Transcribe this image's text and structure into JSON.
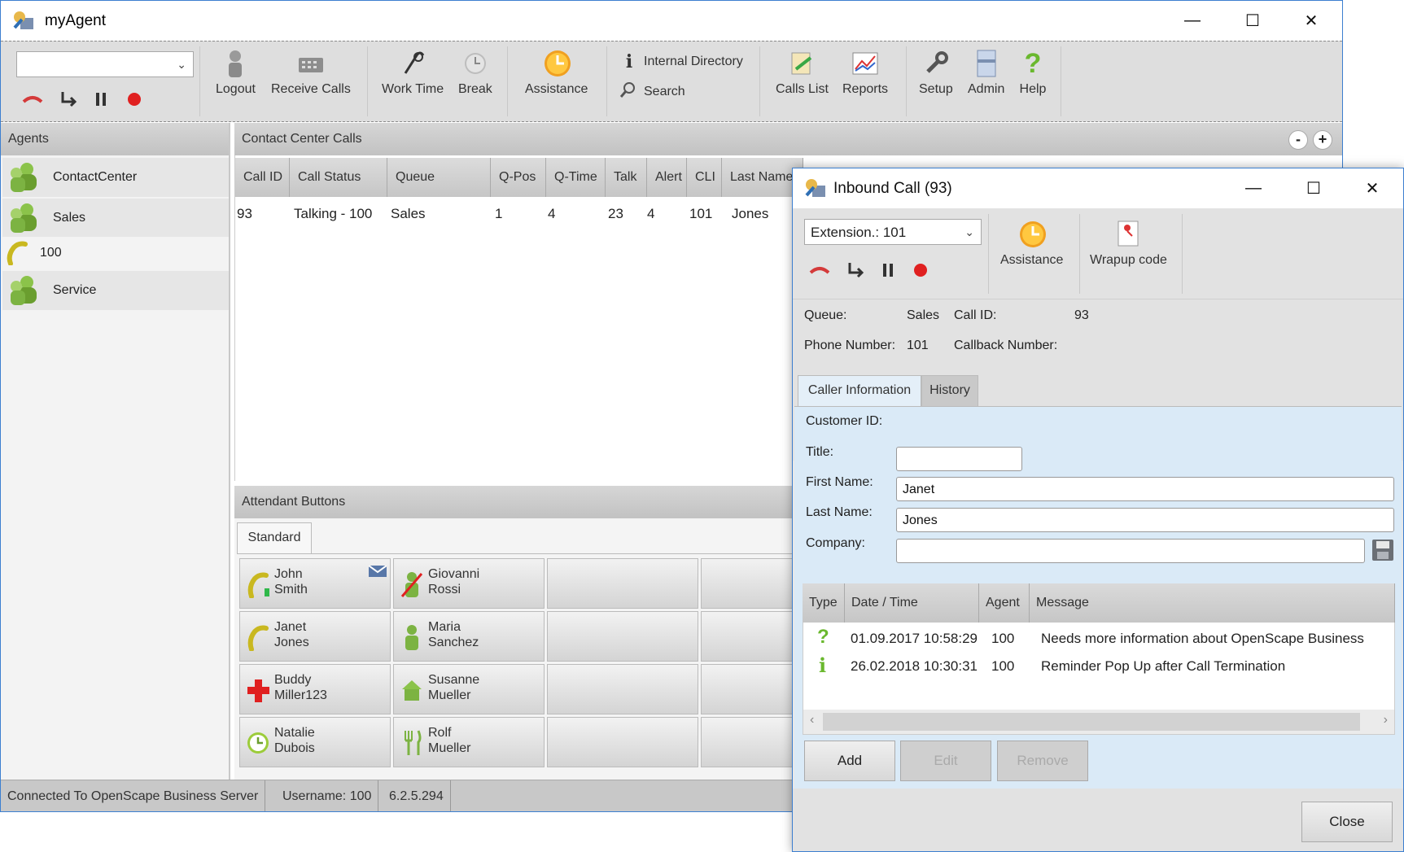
{
  "main": {
    "title": "myAgent",
    "window_controls": {
      "minimize": "—",
      "maximize": "☐",
      "close": "✕"
    },
    "toolbar": {
      "combo_value": "",
      "buttons": {
        "logout": "Logout",
        "receive_calls": "Receive Calls",
        "work_time": "Work Time",
        "break": "Break",
        "assistance": "Assistance",
        "internal_directory": "Internal Directory",
        "search": "Search",
        "calls_list": "Calls List",
        "reports": "Reports",
        "setup": "Setup",
        "admin": "Admin",
        "help": "Help"
      }
    },
    "agents_panel": {
      "title": "Agents",
      "items": [
        {
          "label": "ContactCenter",
          "icon": "agents-group-icon"
        },
        {
          "label": "Sales",
          "icon": "agents-group-icon"
        },
        {
          "label": "100",
          "icon": "phone-handset-icon"
        },
        {
          "label": "Service",
          "icon": "agents-group-icon"
        }
      ]
    },
    "calls_panel": {
      "title": "Contact Center Calls",
      "collapse": "-",
      "expand": "+",
      "columns": [
        "Call ID",
        "Call Status",
        "Queue",
        "Q-Pos",
        "Q-Time",
        "Talk",
        "Alert",
        "CLI",
        "Last Name"
      ],
      "rows": [
        [
          "93",
          "Talking - 100",
          "Sales",
          "1",
          "4",
          "23",
          "4",
          "101",
          "Jones"
        ]
      ]
    },
    "attendant_panel": {
      "title": "Attendant Buttons",
      "tab": "Standard",
      "buttons": [
        {
          "line1": "John",
          "line2": "Smith",
          "icon": "phone-busy-icon"
        },
        {
          "line1": "Giovanni",
          "line2": "Rossi",
          "icon": "person-dnd-icon"
        },
        {
          "line1": "Janet",
          "line2": "Jones",
          "icon": "phone-busy-icon"
        },
        {
          "line1": "Maria",
          "line2": "Sanchez",
          "icon": "person-available-icon"
        },
        {
          "line1": "Buddy",
          "line2": "Miller123",
          "icon": "sick-cross-icon"
        },
        {
          "line1": "Susanne",
          "line2": "Mueller",
          "icon": "home-icon"
        },
        {
          "line1": "Natalie",
          "line2": "Dubois",
          "icon": "clock-icon"
        },
        {
          "line1": "Rolf",
          "line2": "Mueller",
          "icon": "lunch-fork-icon"
        }
      ]
    },
    "status": {
      "connection": "Connected To OpenScape Business Server",
      "username": "Username: 100",
      "version": "6.2.5.294"
    }
  },
  "dialog": {
    "title": "Inbound Call (93)",
    "extension": "Extension.: 101",
    "assistance": "Assistance",
    "wrapup": "Wrapup code",
    "queue_label": "Queue:",
    "queue_value": "Sales",
    "callid_label": "Call ID:",
    "callid_value": "93",
    "phone_label": "Phone Number:",
    "phone_value": "101",
    "callback_label": "Callback Number:",
    "callback_value": "",
    "tabs": [
      "Caller Information",
      "History"
    ],
    "customer_id_label": "Customer ID:",
    "title_label": "Title:",
    "title_value": "",
    "first_name_label": "First Name:",
    "first_name_value": "Janet",
    "last_name_label": "Last Name:",
    "last_name_value": "Jones",
    "company_label": "Company:",
    "company_value": "",
    "messages": {
      "columns": [
        "Type",
        "Date / Time",
        "Agent",
        "Message"
      ],
      "rows": [
        {
          "type": "question-icon",
          "datetime": "01.09.2017 10:58:29",
          "agent": "100",
          "message": "Needs more information about OpenScape Business"
        },
        {
          "type": "info-icon",
          "datetime": "26.02.2018 10:30:31",
          "agent": "100",
          "message": "Reminder Pop Up after Call Termination"
        }
      ]
    },
    "add": "Add",
    "edit": "Edit",
    "remove": "Remove",
    "close": "Close"
  }
}
